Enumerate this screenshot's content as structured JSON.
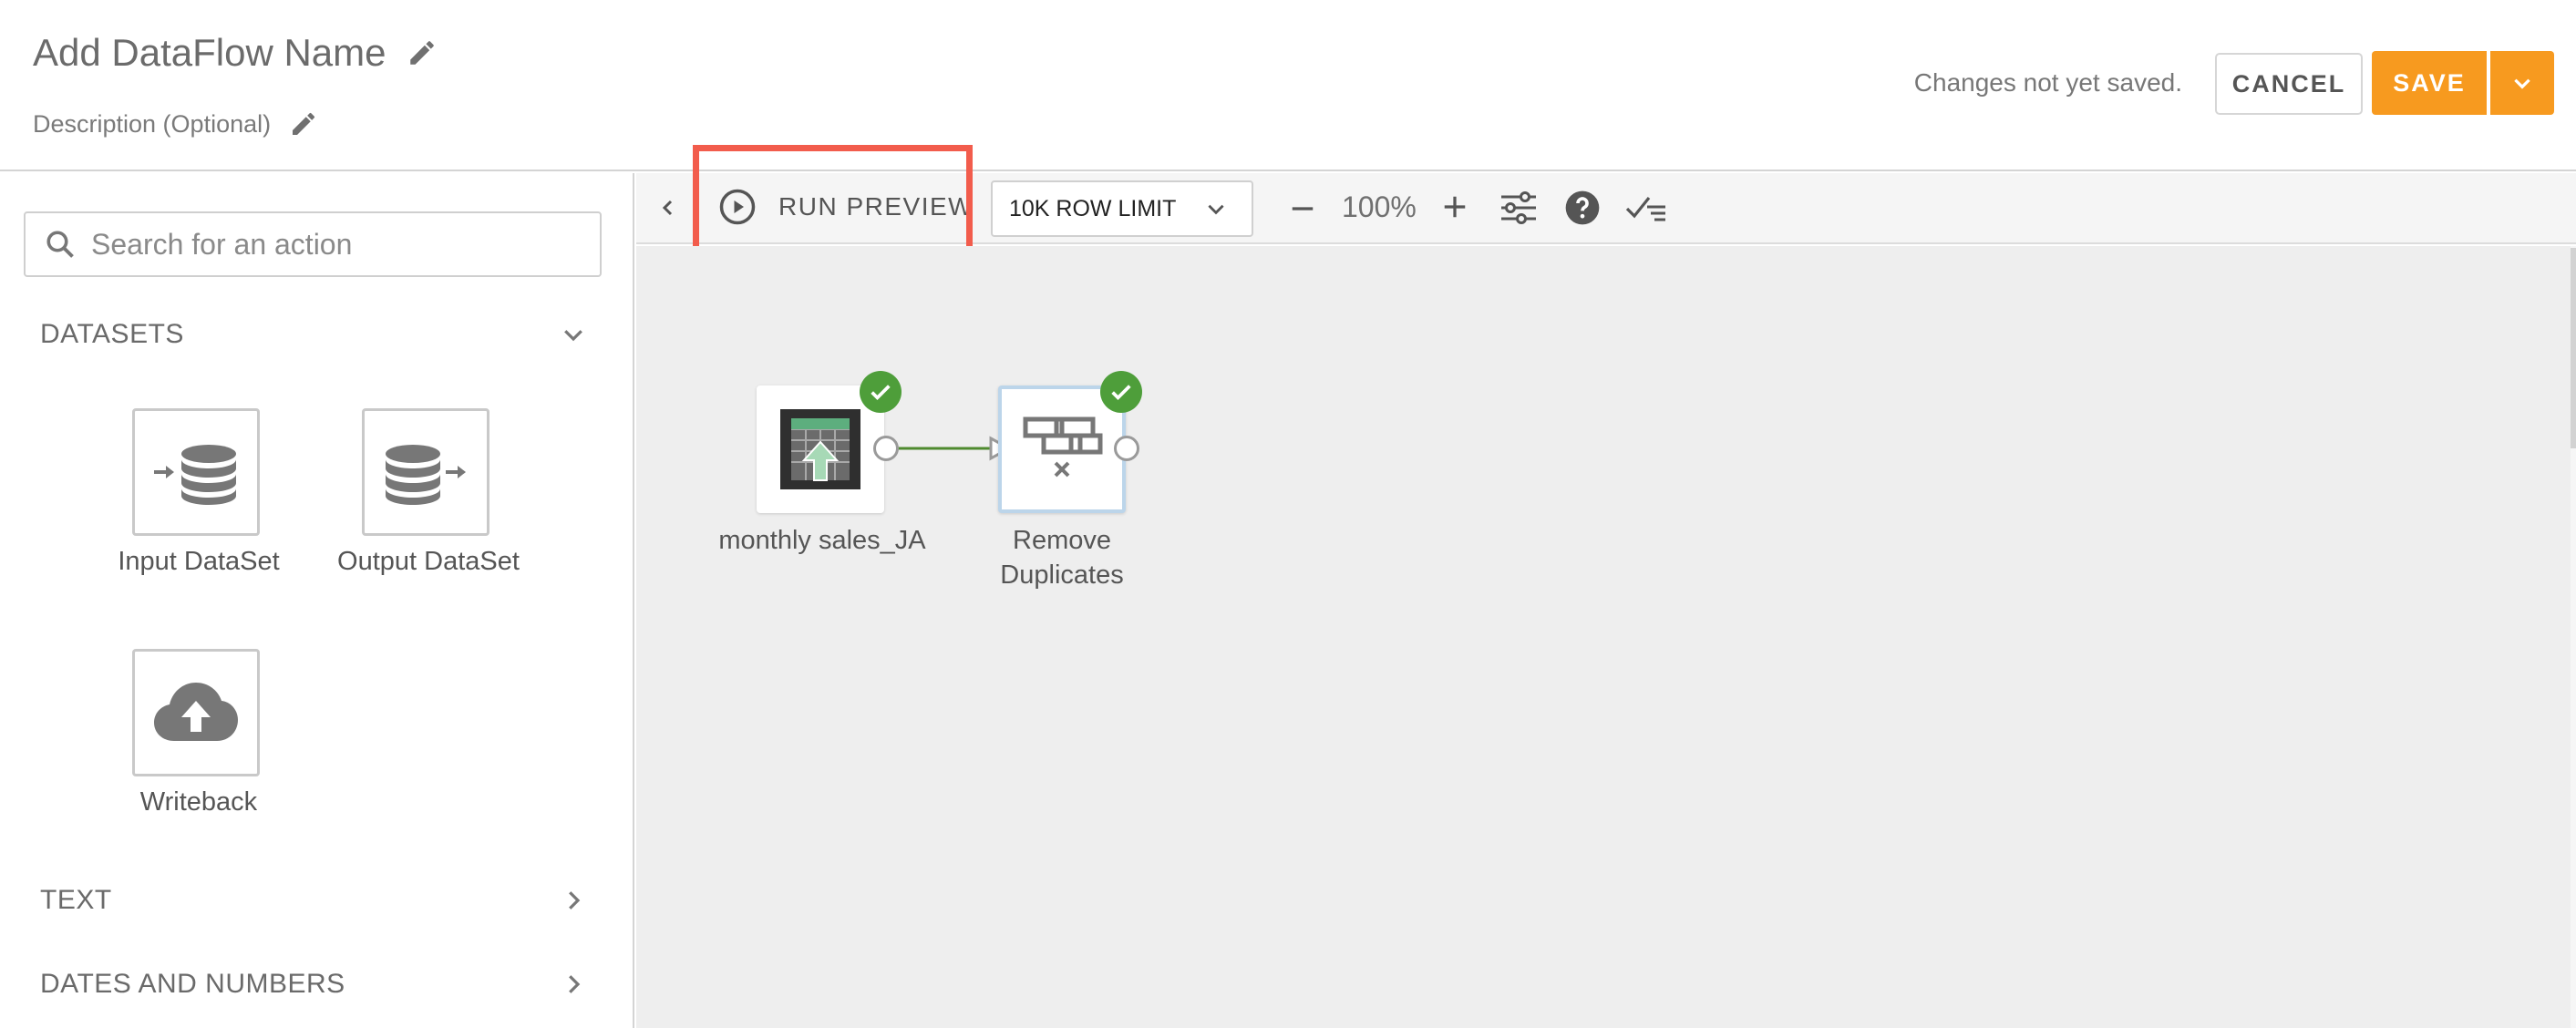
{
  "header": {
    "title": "Add DataFlow Name",
    "description": "Description (Optional)",
    "status": "Changes not yet saved.",
    "cancel_label": "CANCEL",
    "save_label": "SAVE"
  },
  "sidebar": {
    "search_placeholder": "Search for an action",
    "sections": [
      {
        "label": "DATASETS",
        "expanded": true
      },
      {
        "label": "TEXT",
        "expanded": false
      },
      {
        "label": "DATES AND NUMBERS",
        "expanded": false
      }
    ],
    "tiles": [
      {
        "label": "Input DataSet",
        "icon": "input-dataset-icon"
      },
      {
        "label": "Output DataSet",
        "icon": "output-dataset-icon"
      },
      {
        "label": "Writeback",
        "icon": "cloud-upload-icon"
      }
    ]
  },
  "toolbar": {
    "run_preview_label": "RUN PREVIEW",
    "row_limit": "10K ROW LIMIT",
    "zoom": "100%"
  },
  "canvas": {
    "nodes": [
      {
        "label": "monthly sales_JA",
        "status": "valid",
        "icon": "spreadsheet-upload-icon"
      },
      {
        "label_line1": "Remove",
        "label_line2": "Duplicates",
        "status": "valid",
        "icon": "remove-duplicates-icon"
      }
    ]
  },
  "colors": {
    "accent": "#f79a1f",
    "highlight": "#f25c4c",
    "success": "#4e9e3a",
    "connector": "#4e8a2e"
  }
}
